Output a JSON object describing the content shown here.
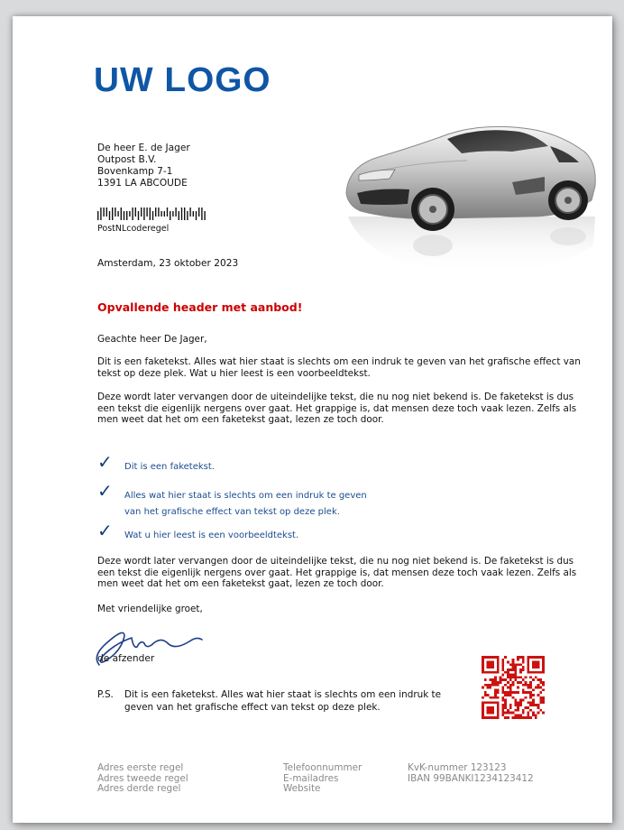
{
  "logo": "UW LOGO",
  "recipient": {
    "line1": "De heer E. de Jager",
    "line2": "Outpost B.V.",
    "line3": "Bovenkamp 7-1",
    "line4": "1391 LA  ABCOUDE"
  },
  "barcode_label": "PostNLcoderegel",
  "date": "Amsterdam, 23 oktober 2023",
  "headline": "Opvallende header met aanbod!",
  "salutation": "Geachte heer  De Jager,",
  "paragraph1": "Dit is een faketekst. Alles wat hier staat is slechts om een indruk te geven van het grafische effect van tekst op deze plek. Wat u hier leest is een voorbeeldtekst.",
  "paragraph2": "Deze wordt later vervangen door de uiteindelijke tekst, die nu nog niet bekend is. De faketekst is dus een tekst die eigenlijk nergens over gaat. Het grappige is, dat mensen deze toch vaak lezen. Zelfs als men weet dat het om een faketekst gaat, lezen ze toch door.",
  "checklist": [
    {
      "line1": "Dit is een faketekst.",
      "line2": ""
    },
    {
      "line1": "Alles wat hier staat is slechts om een indruk te geven",
      "line2": "van het grafische effect van tekst op deze plek."
    },
    {
      "line1": "Wat u hier leest is een voorbeeldtekst.",
      "line2": ""
    }
  ],
  "paragraph3": "Deze wordt later vervangen door de uiteindelijke tekst, die nu nog niet bekend is. De faketekst is dus een tekst die eigenlijk nergens over gaat. Het grappige is, dat mensen deze toch vaak lezen. Zelfs als men weet dat het om een faketekst gaat, lezen ze toch door.",
  "closing": "Met vriendelijke groet,",
  "sender": "de afzender",
  "ps_label": "P.S.",
  "ps_text": "Dit is een faketekst. Alles wat hier staat is slechts om een indruk te geven van het grafische effect van tekst op deze plek.",
  "footer": {
    "col1": [
      "Adres eerste regel",
      "Adres tweede regel",
      "Adres derde regel"
    ],
    "col2": [
      "Telefoonnummer",
      "E-mailadres",
      "Website"
    ],
    "col3": [
      "KvK-nummer 123123",
      "IBAN 99BANKI1234123412"
    ]
  },
  "colors": {
    "logo": "#0f56a5",
    "headline": "#cc0000",
    "checklist": "#1a4c8f",
    "qr": "#cc1111",
    "footer": "#8a8a8a"
  },
  "icons": {
    "check": "check-mark-icon",
    "qr": "qr-code-icon",
    "car": "sports-car-image",
    "signature": "signature-image",
    "barcode": "barcode-icon"
  }
}
